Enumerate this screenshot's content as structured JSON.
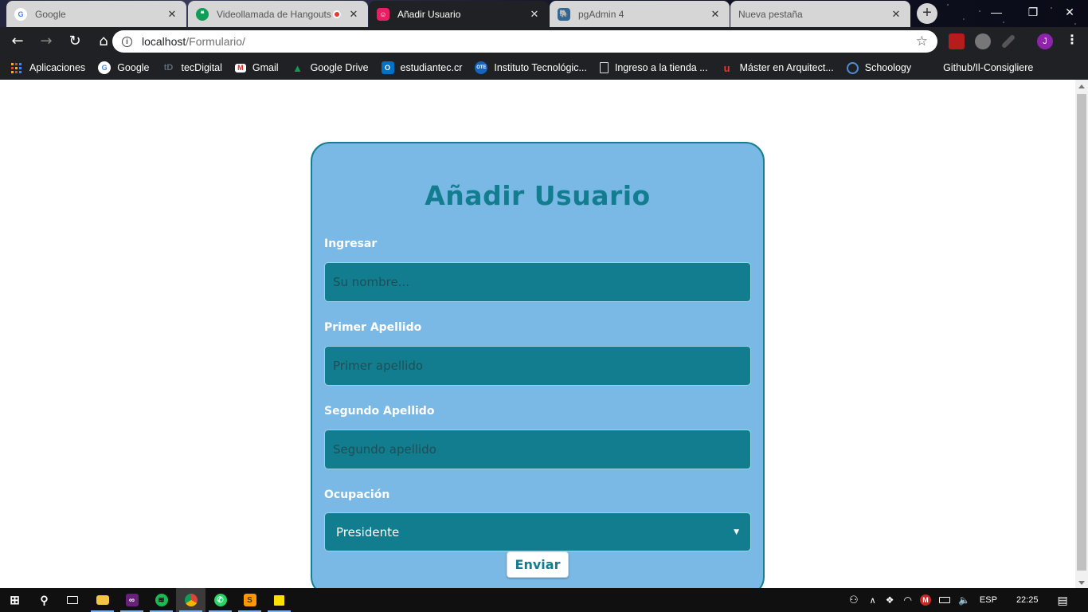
{
  "browser": {
    "tabs": [
      {
        "title": "Google",
        "icon": "google-icon",
        "active": false
      },
      {
        "title": "Videollamada de Hangouts",
        "icon": "hangouts-icon",
        "active": false,
        "recording": true
      },
      {
        "title": "Añadir Usuario",
        "icon": "page-icon",
        "active": true
      },
      {
        "title": "pgAdmin 4",
        "icon": "pgadmin-icon",
        "active": false
      },
      {
        "title": "Nueva pestaña",
        "icon": "",
        "active": false
      }
    ],
    "url_host": "localhost",
    "url_path": "/Formulario/",
    "profile_initial": "J",
    "bookmarks": [
      {
        "label": "Aplicaciones",
        "icon": "apps-grid-icon"
      },
      {
        "label": "Google",
        "icon": "google-icon"
      },
      {
        "label": "tecDigital",
        "icon": "tecdigital-icon"
      },
      {
        "label": "Gmail",
        "icon": "gmail-icon"
      },
      {
        "label": "Google Drive",
        "icon": "google-drive-icon"
      },
      {
        "label": "estudiantec.cr",
        "icon": "outlook-icon"
      },
      {
        "label": "Instituto Tecnológic...",
        "icon": "tec-icon"
      },
      {
        "label": "Ingreso a la tienda ...",
        "icon": "document-icon"
      },
      {
        "label": "Máster en Arquitect...",
        "icon": "university-icon"
      },
      {
        "label": "Schoology",
        "icon": "schoology-icon"
      },
      {
        "label": "Github/Il-Consigliere",
        "icon": ""
      }
    ]
  },
  "form": {
    "title": "Añadir Usuario",
    "fields": [
      {
        "label": "Ingresar",
        "placeholder": "Su nombre..."
      },
      {
        "label": "Primer Apellido",
        "placeholder": "Primer apellido"
      },
      {
        "label": "Segundo Apellido",
        "placeholder": "Segundo apellido"
      }
    ],
    "occupation_label": "Ocupación",
    "occupation_value": "Presidente",
    "submit_label": "Enviar"
  },
  "taskbar": {
    "language": "ESP",
    "time": "22:25"
  },
  "colors": {
    "card_bg": "#7ab8e6",
    "accent": "#117d8e",
    "chrome_dark": "#202124"
  }
}
